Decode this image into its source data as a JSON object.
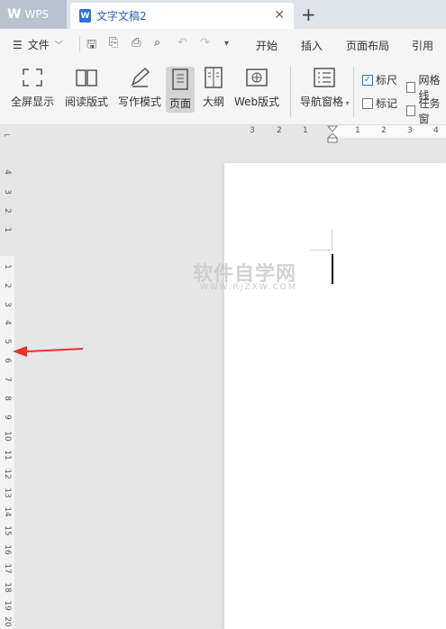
{
  "titlebar": {
    "app_tab": "WPS",
    "doc_tab": "文字文稿2",
    "close_symbol": "✕",
    "add_symbol": "+"
  },
  "menubar": {
    "file_label": "文件",
    "items": [
      "开始",
      "插入",
      "页面布局",
      "引用"
    ]
  },
  "ribbon": {
    "buttons": [
      {
        "label": "全屏显示",
        "icon": "fullscreen-icon"
      },
      {
        "label": "阅读版式",
        "icon": "book-icon"
      },
      {
        "label": "写作模式",
        "icon": "pen-icon"
      },
      {
        "label": "页面",
        "icon": "page-icon",
        "active": true
      },
      {
        "label": "大纲",
        "icon": "outline-icon"
      },
      {
        "label": "Web版式",
        "icon": "web-icon"
      },
      {
        "label": "导航窗格",
        "icon": "nav-pane-icon"
      }
    ],
    "checkboxes": [
      {
        "label": "标尺",
        "checked": true
      },
      {
        "label": "网格线",
        "checked": false
      },
      {
        "label": "标记",
        "checked": false
      },
      {
        "label": "任务窗",
        "checked": false
      }
    ]
  },
  "ruler": {
    "horizontal": [
      "3",
      "2",
      "1",
      "1",
      "2",
      "3",
      "4"
    ],
    "vertical_top": [
      "4",
      "3",
      "2",
      "1"
    ],
    "vertical_main": [
      "1",
      "2",
      "3",
      "4",
      "5",
      "6",
      "7",
      "8",
      "9",
      "10",
      "11",
      "12",
      "13",
      "14",
      "15",
      "16",
      "17",
      "18",
      "19",
      "20"
    ]
  },
  "watermark": {
    "main": "软件自学网",
    "sub": "WWW.RJZXW.COM"
  },
  "colors": {
    "accent": "#1f6fd6",
    "arrow": "#e8302f"
  }
}
